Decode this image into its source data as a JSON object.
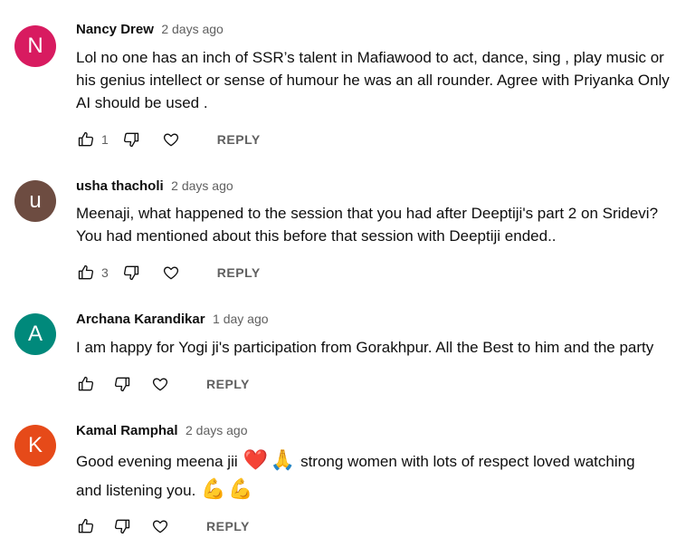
{
  "comments": [
    {
      "author": "Nancy Drew",
      "time": "2 days ago",
      "initial": "N",
      "avatar_color": "#d81b60",
      "lines": [
        "Lol no one has an inch of SSR’s talent in Mafiawood to act,  dance, sing , play music or",
        "his genius intellect or sense of humour he was an all rounder. Agree with Priyanka Only",
        "AI should be used ."
      ],
      "likes": "1",
      "reply_label": "REPLY"
    },
    {
      "author": "usha thacholi",
      "time": "2 days ago",
      "initial": "u",
      "avatar_color": "#6d4c41",
      "lines": [
        "Meenaji, what happened to the session that you had after Deeptiji's part 2 on Sridevi?",
        "You had mentioned about this before that session with Deeptiji ended.."
      ],
      "likes": "3",
      "reply_label": "REPLY"
    },
    {
      "author": "Archana Karandikar",
      "time": "1 day ago",
      "initial": "A",
      "avatar_color": "#00897b",
      "lines": [
        "I am happy for Yogi ji's participation from Gorakhpur. All the Best to him and the party"
      ],
      "likes": "",
      "reply_label": "REPLY"
    },
    {
      "author": "Kamal Ramphal",
      "time": "2 days ago",
      "initial": "K",
      "avatar_color": "#e64a19",
      "line1_a": "Good evening meena jii ",
      "emoji_heart": "❤️",
      "emoji_pray": "🙏",
      "line1_b": " strong  women with lots of respect loved watching",
      "line2_a": "and listening you. ",
      "emoji_muscle_1": "💪",
      "emoji_muscle_2": "💪",
      "likes": "",
      "reply_label": "REPLY"
    }
  ],
  "icons": {
    "like": "thumb-up-icon",
    "dislike": "thumb-down-icon",
    "heart": "heart-outline-icon"
  }
}
